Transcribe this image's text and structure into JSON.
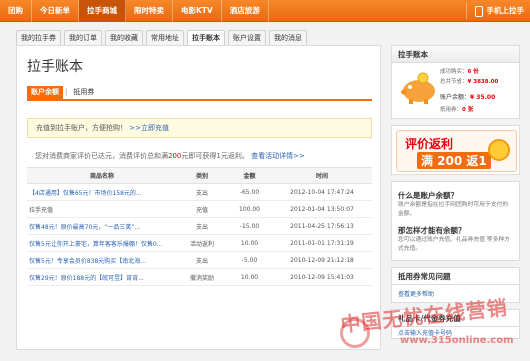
{
  "nav": {
    "items": [
      "团购",
      "今日新单",
      "拉手商城",
      "限时特卖",
      "电影KTV",
      "酒店旅游"
    ],
    "active_index": 2,
    "mobile_label": "手机上拉手"
  },
  "tabs": [
    "我的拉手券",
    "我的订单",
    "我的收藏",
    "常用地址",
    "拉手账本",
    "账户设置",
    "我的消息"
  ],
  "active_tab": 4,
  "main": {
    "title": "拉手账本",
    "subtabs": [
      "账户余额",
      "抵用券"
    ],
    "notice": "充值到拉手账户，方便抢购！",
    "notice_link": ">>立即充值",
    "eval_pre": "您对消费商家评价已达元，消费评价总和满",
    "eval_amount": "200",
    "eval_post": "元即可获得1元返利。",
    "eval_link": "查看活动详情>>"
  },
  "table": {
    "headers": [
      "商品名称",
      "类别",
      "金额",
      "时间"
    ],
    "rows": [
      {
        "name": "【4店通用】仅售65元！市场价158元的...",
        "type": "支出",
        "amount": "-65.00",
        "time": "2012-10-04 17:47:24",
        "link": true
      },
      {
        "name": "拉手充值",
        "type": "充值",
        "amount": "100.00",
        "time": "2012-01-04 13:50:07",
        "link": false
      },
      {
        "name": "仅售48元！原价最高70元，“一品三笑”...",
        "type": "支出",
        "amount": "-15.00",
        "time": "2011-04-25 17:56:13",
        "link": true
      },
      {
        "name": "仅售5元让你开上豪宅，算年客客乐爆棚！仅售0...",
        "type": "活动返利",
        "amount": "10.00",
        "time": "2011-01-01 17:31:19",
        "link": true
      },
      {
        "name": "仅售5元！专享会员价838元购买【南北海...",
        "type": "支出",
        "amount": "-5.00",
        "time": "2010-12-09 21:12:18",
        "link": true
      },
      {
        "name": "仅售29元！原价188元的【皖可昱】宵宵...",
        "type": "撤消奖励",
        "amount": "10.00",
        "time": "2010-12-09 15:41:03",
        "link": true
      }
    ]
  },
  "sidebar": {
    "account_title": "拉手账本",
    "purchase_label": "成功购买：",
    "purchase_value": "6 份",
    "saved_label": "总共节省：",
    "saved_value": "¥ 3838.00",
    "balance_label": "账户余额：",
    "balance_value": "¥ 35.00",
    "voucher_label": "抵用券：",
    "voucher_value": "0 张",
    "promo_line1": "评价返利",
    "promo_line2": "满 200 返1",
    "faq_q1": "什么是账户余额？",
    "faq_a1": "账户余额是指在拉手网团购时可用于支付的金额。",
    "faq_q2": "那怎样才能有余额？",
    "faq_a2": "您可以通过账户充值、礼品券充值 等多种方式充值。",
    "help_title": "抵用券常见问题",
    "help_link": "查看更多帮助",
    "gift_title": "礼品卡/代金券充值",
    "gift_link": "点击输入充值卡号码"
  },
  "watermark": {
    "text": "中国无忧在线营销",
    "url": "www.315online.com"
  }
}
